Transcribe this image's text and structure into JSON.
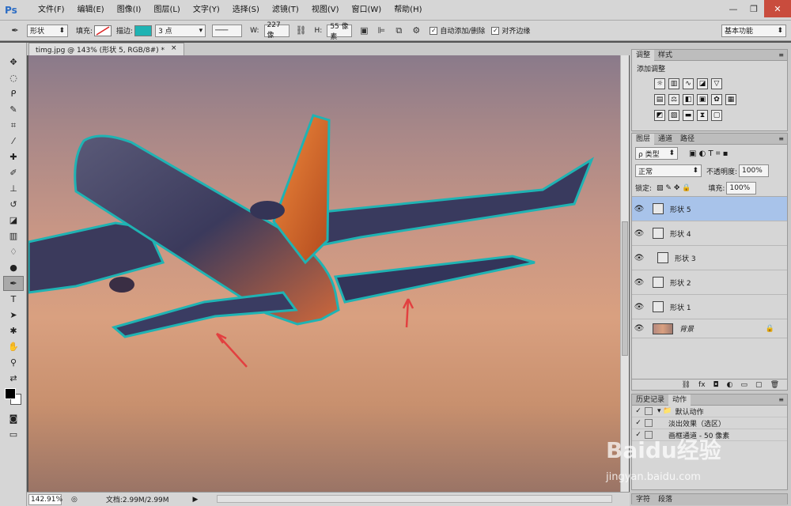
{
  "app": {
    "logo": "Ps"
  },
  "menu": [
    "文件(F)",
    "编辑(E)",
    "图像(I)",
    "图层(L)",
    "文字(Y)",
    "选择(S)",
    "滤镜(T)",
    "视图(V)",
    "窗口(W)",
    "帮助(H)"
  ],
  "window_controls": {
    "minimize": "—",
    "restore": "❐",
    "close": "✕"
  },
  "options": {
    "mode": "形状",
    "fill_label": "填充:",
    "stroke_label": "描边:",
    "stroke_size": "3 点",
    "w_label": "W:",
    "w_value": "227 像",
    "h_label": "H:",
    "h_value": "55 像素",
    "auto_add_label": "自动添加/删除",
    "align_edges_label": "对齐边缘",
    "workspace": "基本功能",
    "stroke_color": "#1fb3b3"
  },
  "document": {
    "tab_title": "timg.jpg @ 143% (形状 5, RGB/8#) *",
    "close": "×"
  },
  "status": {
    "zoom": "142.91%",
    "doc_info": "文档:2.99M/2.99M"
  },
  "adjustments": {
    "tabs": [
      "调整",
      "样式"
    ],
    "title": "添加调整"
  },
  "layers_panel": {
    "tabs": [
      "图层",
      "通道",
      "路径"
    ],
    "filter_kind": "ρ 类型",
    "blend_mode": "正常",
    "opacity_label": "不透明度:",
    "opacity_value": "100%",
    "lock_label": "锁定:",
    "fill_label": "填充:",
    "fill_value": "100%",
    "layers": [
      {
        "name": "形状 5",
        "selected": true
      },
      {
        "name": "形状 4",
        "selected": false
      },
      {
        "name": "形状 3",
        "selected": false
      },
      {
        "name": "形状 2",
        "selected": false
      },
      {
        "name": "形状 1",
        "selected": false
      },
      {
        "name": "背景",
        "selected": false
      }
    ]
  },
  "actions_panel": {
    "tabs": [
      "历史记录",
      "动作"
    ],
    "items": [
      "默认动作",
      "淡出效果（选区）",
      "画框通道 - 50 像素"
    ]
  },
  "bottom_tabs": [
    "字符",
    "段落"
  ],
  "watermark": {
    "line1": "Baidu经验",
    "line2": "jingyan.baidu.com"
  }
}
